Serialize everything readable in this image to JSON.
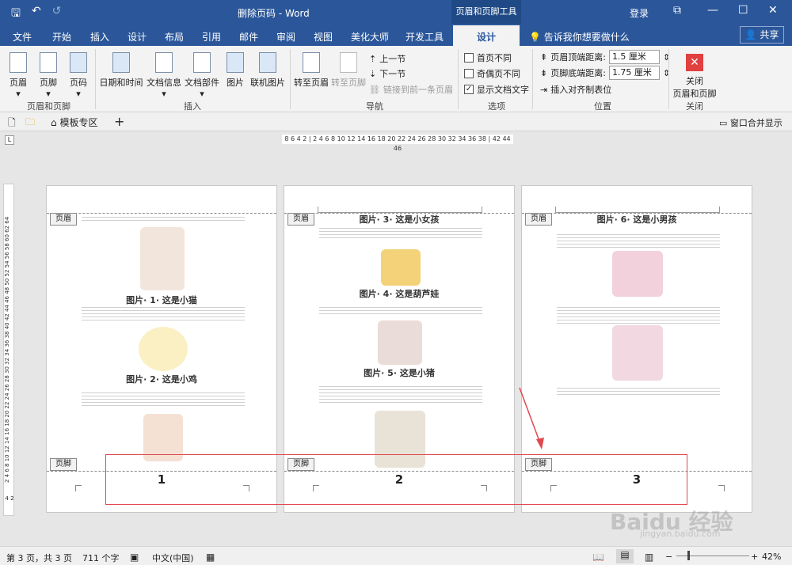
{
  "title_bar": {
    "title": "删除页码 - Word",
    "context_tool": "页眉和页脚工具",
    "login": "登录",
    "restore": "⧉",
    "minimize": "—",
    "maximize": "☐",
    "close": "✕",
    "save_icon": "🖫",
    "undo_icon": "↶",
    "redo_icon": "↺"
  },
  "tabs": [
    "文件",
    "开始",
    "插入",
    "设计",
    "布局",
    "引用",
    "邮件",
    "审阅",
    "视图",
    "美化大师",
    "开发工具"
  ],
  "active_tab": "设计",
  "tell_me": "告诉我你想要做什么",
  "share": "共享",
  "ribbon": {
    "hf_group": {
      "label": "页眉和页脚",
      "items": [
        "页眉",
        "页脚",
        "页码"
      ]
    },
    "insert_group": {
      "label": "插入",
      "items": [
        "日期和时间",
        "文档信息",
        "文档部件",
        "图片",
        "联机图片"
      ]
    },
    "nav_group": {
      "label": "导航",
      "goto_header": "转至页眉",
      "goto_footer": "转至页脚",
      "prev": "上一节",
      "next": "下一节",
      "link_prev": "链接到前一条页眉"
    },
    "options_group": {
      "label": "选项",
      "first": "首页不同",
      "oddeven": "奇偶页不同",
      "show_text": "显示文档文字",
      "first_checked": false,
      "oddeven_checked": false,
      "show_checked": true
    },
    "position_group": {
      "label": "位置",
      "header_top_label": "页眉顶端距离:",
      "header_top_value": "1.5 厘米",
      "footer_bottom_label": "页脚底端距离:",
      "footer_bottom_value": "1.75 厘米",
      "align_tab": "插入对齐制表位"
    },
    "close_group": {
      "label": "关闭",
      "btn1": "关闭",
      "btn2": "页眉和页脚"
    }
  },
  "tabstrip": {
    "template": "模板专区",
    "plus": "+",
    "merge": "窗口合并显示"
  },
  "ruler_text": "8 6 4 2 | 2 4 6 8 10 12 14 16 18 20 22 24 26 28 30 32 34 36 38 | 42 44 46",
  "vruler_text": "2 4 6 8 10 12 14 16 18 20 22 24 26 28 30 32 34 36 38 40 42 44 46 48 50 52 54 56 58 60 62 64",
  "vruler_bottom": "4 2",
  "pages": [
    {
      "header_tag": "页眉",
      "footer_tag": "页脚",
      "number": "1",
      "captions": [
        "图片· 1· 这是小猫",
        "图片· 2· 这是小鸡"
      ]
    },
    {
      "header_tag": "页眉",
      "footer_tag": "页脚",
      "number": "2",
      "captions": [
        "图片· 3· 这是小女孩",
        "图片· 4· 这是葫芦娃",
        "图片· 5· 这是小猪"
      ]
    },
    {
      "header_tag": "页眉",
      "footer_tag": "页脚",
      "number": "3",
      "captions": [
        "图片· 6· 这是小男孩"
      ]
    }
  ],
  "status": {
    "page": "第 3 页，共 3 页",
    "words": "711 个字",
    "lang": "中文(中国)",
    "zoom": "42%"
  },
  "watermark": {
    "brand": "Baidu 经验",
    "url": "jingyan.baidu.com"
  }
}
